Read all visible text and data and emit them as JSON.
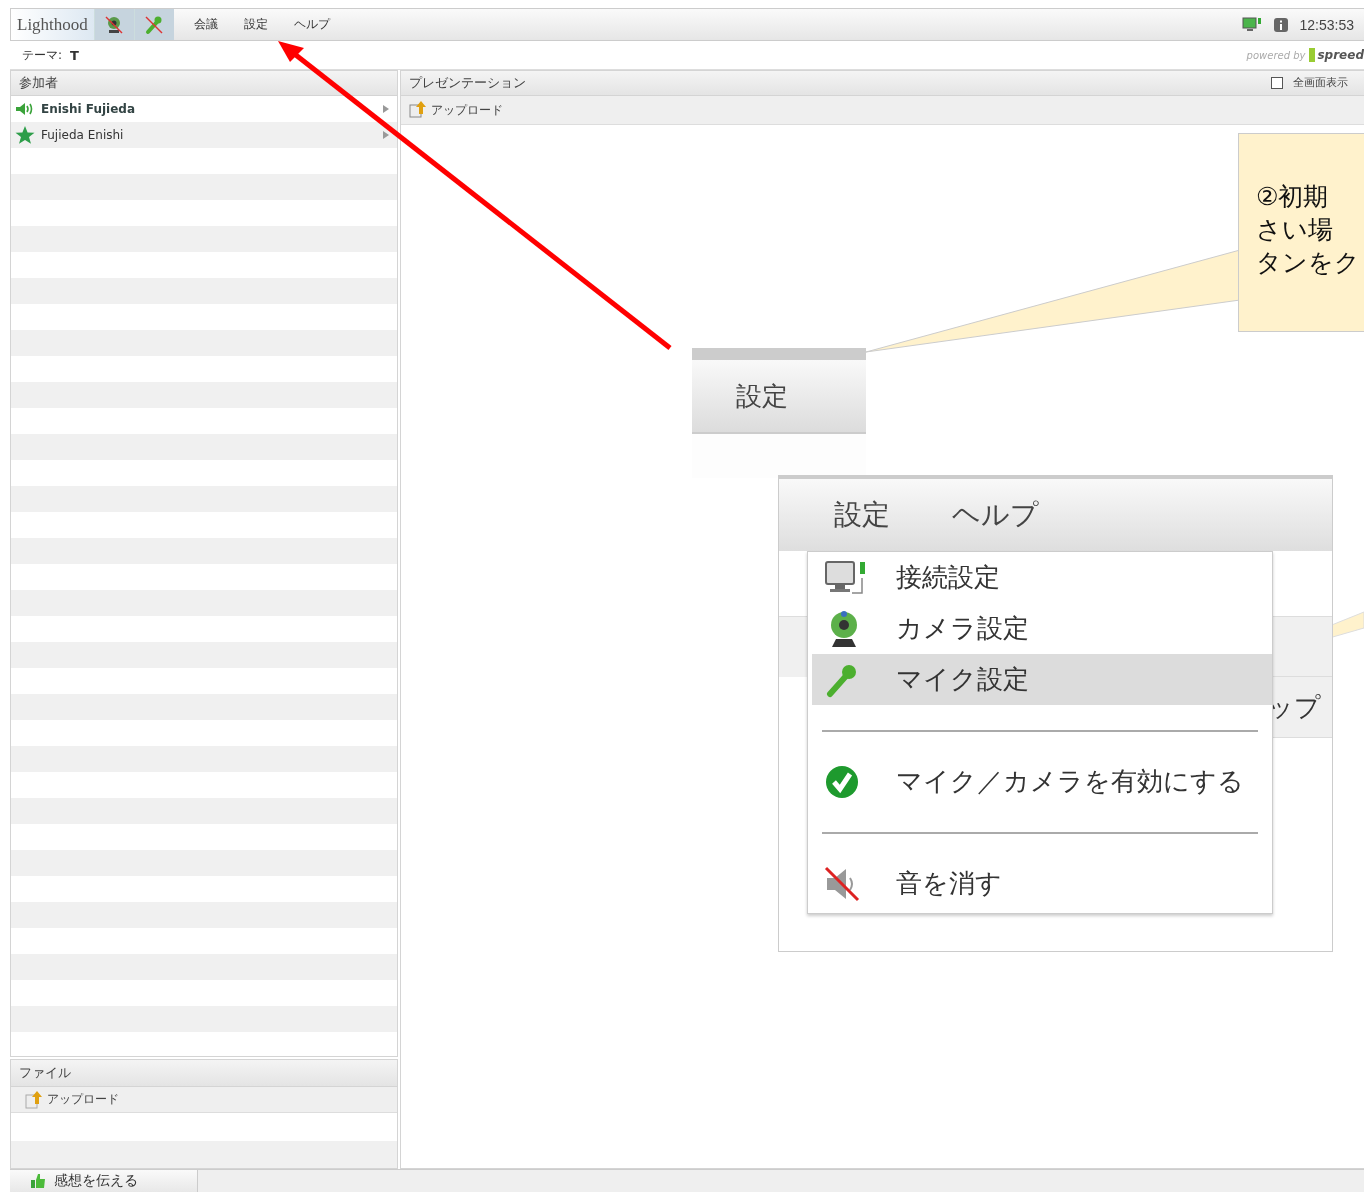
{
  "menu_bar": {
    "logo": "Lighthood",
    "menus": [
      "会議",
      "設定",
      "ヘルプ"
    ],
    "clock": "12:53:53"
  },
  "theme": {
    "label": "テーマ:",
    "value": "T",
    "powered_by": "powered by",
    "brand": "spreed"
  },
  "participants": {
    "title": "参加者",
    "items": [
      {
        "name": "Enishi Fujieda",
        "kind": "speaker"
      },
      {
        "name": "Fujieda Enishi",
        "kind": "moderator"
      }
    ]
  },
  "presentation": {
    "title": "プレゼンテーション",
    "fullscreen": {
      "label": "全画面表示",
      "checked": false
    },
    "upload": "アップロード"
  },
  "files": {
    "title": "ファイル",
    "upload": "アップロード"
  },
  "status_bar": {
    "feedback": "感想を伝える"
  },
  "annotation": {
    "callout_lines": [
      "②初期",
      "さい場",
      "タンをク"
    ],
    "inset_menu": "設定",
    "inset_menus": [
      "設定",
      "ヘルプ"
    ],
    "background_fragment": "ップ",
    "dropdown": [
      {
        "label": "接続設定",
        "kind": "connection",
        "selected": false,
        "divider_above": false
      },
      {
        "label": "カメラ設定",
        "kind": "camera",
        "selected": false,
        "divider_above": false
      },
      {
        "label": "マイク設定",
        "kind": "microphone",
        "selected": true,
        "divider_above": false
      },
      {
        "label": "マイク／カメラを有効にする",
        "kind": "enable",
        "selected": false,
        "divider_above": true
      },
      {
        "label": "音を消す",
        "kind": "mute",
        "selected": false,
        "divider_above": true
      }
    ]
  }
}
